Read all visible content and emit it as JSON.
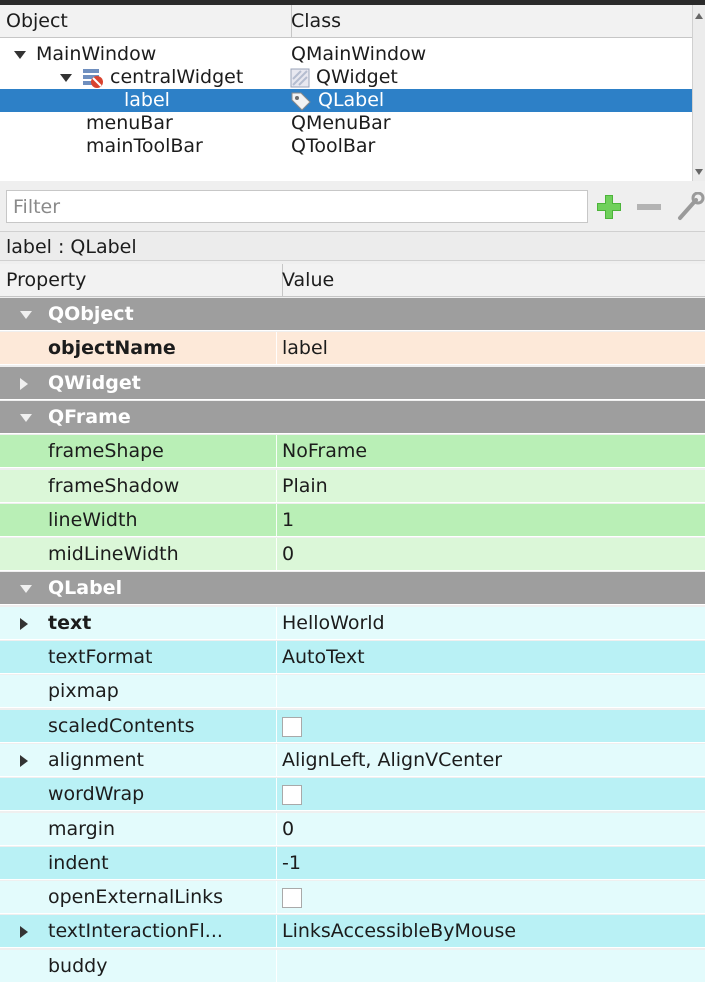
{
  "object_inspector": {
    "headers": {
      "object": "Object",
      "class": "Class"
    },
    "rows": [
      {
        "object": "MainWindow",
        "class": "QMainWindow"
      },
      {
        "object": "centralWidget",
        "class": "QWidget"
      },
      {
        "object": "label",
        "class": "QLabel",
        "selected": true
      },
      {
        "object": "menuBar",
        "class": "QMenuBar"
      },
      {
        "object": "mainToolBar",
        "class": "QToolBar"
      }
    ]
  },
  "filter": {
    "placeholder": "Filter",
    "value": ""
  },
  "current_object": "label : QLabel",
  "property_editor": {
    "headers": {
      "property": "Property",
      "value": "Value"
    },
    "rows": [
      {
        "kind": "group",
        "name": "QObject",
        "expanded": true
      },
      {
        "kind": "prop",
        "name": "objectName",
        "value": "label",
        "bold": true,
        "color": "#fde9d9"
      },
      {
        "kind": "group",
        "name": "QWidget",
        "expanded": false
      },
      {
        "kind": "group",
        "name": "QFrame",
        "expanded": true
      },
      {
        "kind": "prop",
        "name": "frameShape",
        "value": "NoFrame",
        "color": "#b9efb6"
      },
      {
        "kind": "prop",
        "name": "frameShadow",
        "value": "Plain",
        "color": "#dbf7d8"
      },
      {
        "kind": "prop",
        "name": "lineWidth",
        "value": "1",
        "color": "#b9efb6"
      },
      {
        "kind": "prop",
        "name": "midLineWidth",
        "value": "0",
        "color": "#dbf7d8"
      },
      {
        "kind": "group",
        "name": "QLabel",
        "expanded": true
      },
      {
        "kind": "prop",
        "name": "text",
        "value": "HelloWorld",
        "bold": true,
        "expandable": true,
        "color": "#e3fbfc"
      },
      {
        "kind": "prop",
        "name": "textFormat",
        "value": "AutoText",
        "color": "#b9f1f5"
      },
      {
        "kind": "prop",
        "name": "pixmap",
        "value": "",
        "color": "#e3fbfc"
      },
      {
        "kind": "prop",
        "name": "scaledContents",
        "value": "",
        "checkbox": true,
        "color": "#b9f1f5"
      },
      {
        "kind": "prop",
        "name": "alignment",
        "value": "AlignLeft, AlignVCenter",
        "expandable": true,
        "color": "#e3fbfc"
      },
      {
        "kind": "prop",
        "name": "wordWrap",
        "value": "",
        "checkbox": true,
        "color": "#b9f1f5"
      },
      {
        "kind": "prop",
        "name": "margin",
        "value": "0",
        "color": "#e3fbfc"
      },
      {
        "kind": "prop",
        "name": "indent",
        "value": "-1",
        "color": "#b9f1f5"
      },
      {
        "kind": "prop",
        "name": "openExternalLinks",
        "value": "",
        "checkbox": true,
        "color": "#e3fbfc"
      },
      {
        "kind": "prop",
        "name": "textInteractionFl...",
        "value": "LinksAccessibleByMouse",
        "expandable": true,
        "color": "#b9f1f5"
      },
      {
        "kind": "prop",
        "name": "buddy",
        "value": "",
        "color": "#e3fbfc"
      }
    ]
  }
}
